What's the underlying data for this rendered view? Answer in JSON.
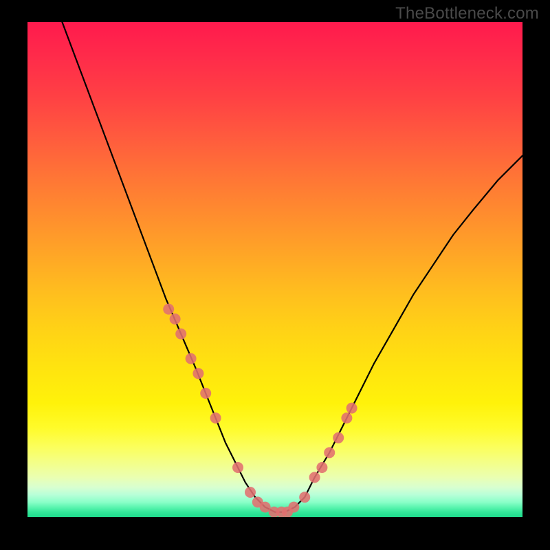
{
  "watermark": "TheBottleneck.com",
  "chart_data": {
    "type": "line",
    "title": "",
    "xlabel": "",
    "ylabel": "",
    "xlim": [
      0,
      100
    ],
    "ylim": [
      0,
      100
    ],
    "grid": false,
    "series": [
      {
        "name": "bottleneck-curve",
        "x": [
          7,
          10,
          13,
          16,
          19,
          22,
          25,
          28,
          31,
          34,
          36,
          38,
          40,
          42,
          44,
          46,
          48,
          50,
          52,
          54,
          56,
          58,
          61,
          64,
          67,
          70,
          74,
          78,
          82,
          86,
          90,
          95,
          100
        ],
        "y": [
          100,
          92,
          84,
          76,
          68,
          60,
          52,
          44,
          37,
          30,
          25,
          20,
          15,
          11,
          7,
          4,
          2,
          1,
          1,
          2,
          4,
          8,
          13,
          19,
          25,
          31,
          38,
          45,
          51,
          57,
          62,
          68,
          73
        ]
      }
    ],
    "markers": {
      "name": "highlight-points",
      "x": [
        28.5,
        29.8,
        31.0,
        33.0,
        34.5,
        36.0,
        38.0,
        42.5,
        45.0,
        46.5,
        48.0,
        49.8,
        51.3,
        52.5,
        53.8,
        56.0,
        58.0,
        59.5,
        61.0,
        62.8,
        64.5,
        65.5
      ],
      "y": [
        42,
        40,
        37,
        32,
        29,
        25,
        20,
        10,
        5,
        3,
        2,
        1,
        1,
        1,
        2,
        4,
        8,
        10,
        13,
        16,
        20,
        22
      ]
    },
    "background": "vertical-rainbow-gradient",
    "annotations": []
  }
}
